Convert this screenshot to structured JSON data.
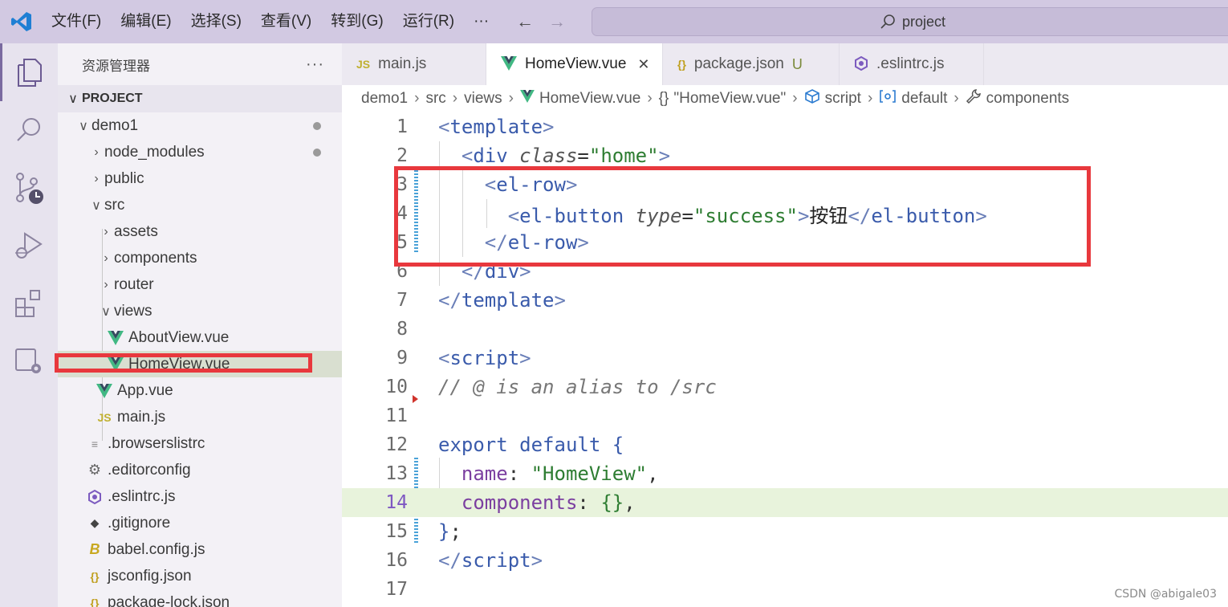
{
  "titlebar": {
    "menu": [
      "文件(F)",
      "编辑(E)",
      "选择(S)",
      "查看(V)",
      "转到(G)",
      "运行(R)"
    ],
    "more": "···",
    "back": "←",
    "forward": "→",
    "search": "project"
  },
  "explorer": {
    "title": "资源管理器",
    "more": "···",
    "section": "PROJECT",
    "items": [
      {
        "label": "demo1"
      },
      {
        "label": "node_modules"
      },
      {
        "label": "public"
      },
      {
        "label": "src"
      },
      {
        "label": "assets"
      },
      {
        "label": "components"
      },
      {
        "label": "router"
      },
      {
        "label": "views"
      },
      {
        "label": "AboutView.vue"
      },
      {
        "label": "HomeView.vue"
      },
      {
        "label": "App.vue"
      },
      {
        "label": "main.js"
      },
      {
        "label": ".browserslistrc"
      },
      {
        "label": ".editorconfig"
      },
      {
        "label": ".eslintrc.js"
      },
      {
        "label": ".gitignore"
      },
      {
        "label": "babel.config.js"
      },
      {
        "label": "jsconfig.json"
      },
      {
        "label": "package-lock.json"
      }
    ]
  },
  "tabs": [
    {
      "label": "main.js",
      "icon": "JS"
    },
    {
      "label": "HomeView.vue",
      "close": "✕"
    },
    {
      "label": "package.json",
      "icon": "{}",
      "modified": "U"
    },
    {
      "label": ".eslintrc.js"
    }
  ],
  "breadcrumb": {
    "parts": [
      "demo1",
      "src",
      "views",
      "HomeView.vue",
      "\"HomeView.vue\"",
      "script",
      "default",
      "components"
    ],
    "obj_icon": "{}"
  },
  "code": {
    "line_numbers": [
      "1",
      "2",
      "3",
      "4",
      "5",
      "6",
      "7",
      "8",
      "9",
      "10",
      "11",
      "12",
      "13",
      "14",
      "15",
      "16",
      "17"
    ],
    "tokens": {
      "template": "template",
      "div": "div",
      "class_attr": "class",
      "home": "\"home\"",
      "el_row": "el-row",
      "el_button": "el-button",
      "type_attr": "type",
      "success": "\"success\"",
      "button_text": "按钮",
      "script": "script",
      "comment": "// @ is an alias to /src",
      "export": "export",
      "default": "default",
      "name_key": "name",
      "name_val": "\"HomeView\"",
      "components_key": "components",
      "components_val": "{}"
    }
  },
  "watermark": "CSDN @abigale03"
}
